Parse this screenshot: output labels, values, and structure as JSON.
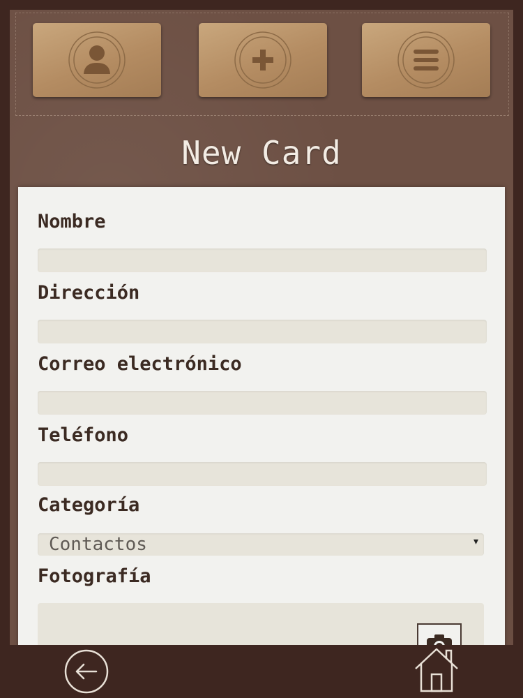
{
  "toolbar": {
    "items": [
      {
        "icon": "user-icon"
      },
      {
        "icon": "plus-icon"
      },
      {
        "icon": "menu-icon"
      }
    ]
  },
  "page": {
    "title": "New Card"
  },
  "form": {
    "name_label": "Nombre",
    "name_value": "",
    "address_label": "Dirección",
    "address_value": "",
    "email_label": "Correo electrónico",
    "email_value": "",
    "phone_label": "Teléfono",
    "phone_value": "",
    "category_label": "Categoría",
    "category_value": "Contactos",
    "photo_label": "Fotografía"
  },
  "bottom_nav": {
    "back_icon": "back-arrow-icon",
    "home_icon": "home-icon"
  },
  "colors": {
    "frame": "#3e2620",
    "background": "#6d5044",
    "card": "#b48c62",
    "panel": "#f2f2ef",
    "input": "#e7e4da",
    "text": "#3b2a22"
  }
}
